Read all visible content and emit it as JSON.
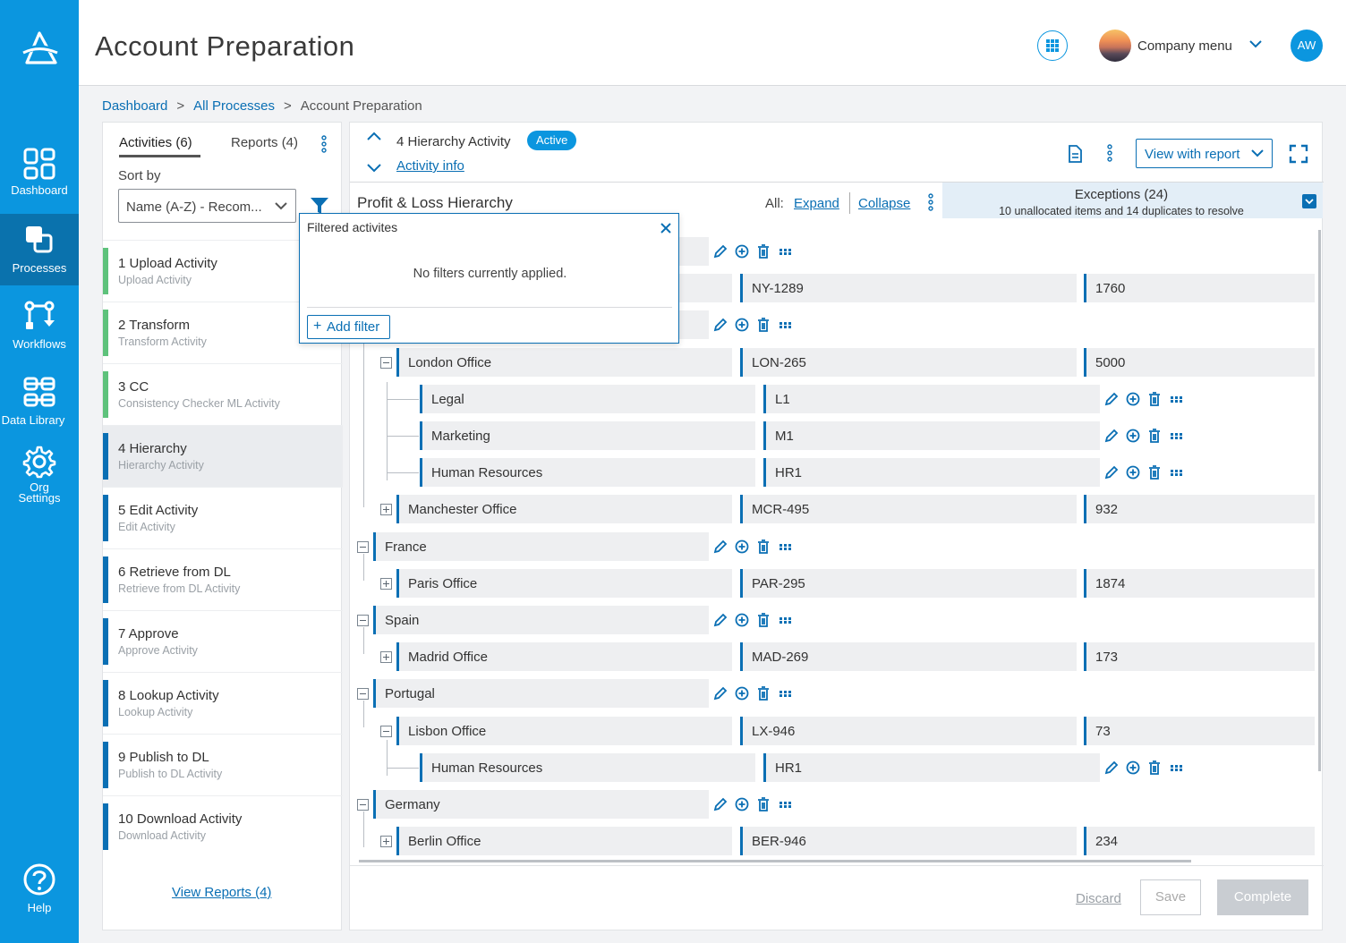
{
  "app": {
    "title": "Account Preparation",
    "accent": "#0b96df"
  },
  "sidebar": {
    "items": [
      {
        "label": "Dashboard",
        "icon": "dashboard-icon"
      },
      {
        "label": "Processes",
        "icon": "processes-icon",
        "active": true
      },
      {
        "label": "Workflows",
        "icon": "workflows-icon"
      },
      {
        "label": "Data Library",
        "icon": "data-library-icon"
      },
      {
        "label": "Org\nSettings",
        "icon": "gear-icon"
      },
      {
        "label": "Help",
        "icon": "help-icon"
      }
    ]
  },
  "header": {
    "company_menu": "Company menu",
    "user_initials": "AW"
  },
  "breadcrumb": {
    "items": [
      "Dashboard",
      "All Processes",
      "Account Preparation"
    ],
    "separator": ">"
  },
  "left": {
    "tab_activities": "Activities (6)",
    "tab_reports": "Reports (4)",
    "sort_by": "Sort by",
    "sort_value": "Name (A-Z) - Recom...",
    "activities": [
      {
        "title": "1 Upload Activity",
        "subtitle": "Upload Activity",
        "color": "#5ec27b"
      },
      {
        "title": "2 Transform",
        "subtitle": "Transform Activity",
        "color": "#5ec27b"
      },
      {
        "title": "3 CC",
        "subtitle": "Consistency Checker ML Activity",
        "color": "#5ec27b"
      },
      {
        "title": "4 Hierarchy",
        "subtitle": "Hierarchy Activity",
        "color": "#0a6fb4"
      },
      {
        "title": "5 Edit Activity",
        "subtitle": "Edit Activity",
        "color": "#0a6fb4"
      },
      {
        "title": "6 Retrieve from DL",
        "subtitle": "Retrieve from DL Activity",
        "color": "#0a6fb4"
      },
      {
        "title": "7 Approve",
        "subtitle": "Approve Activity",
        "color": "#0a6fb4"
      },
      {
        "title": "8 Lookup Activity",
        "subtitle": "Lookup Activity",
        "color": "#0a6fb4"
      },
      {
        "title": "9 Publish to DL",
        "subtitle": "Publish to DL  Activity",
        "color": "#0a6fb4"
      },
      {
        "title": "10 Download Activity",
        "subtitle": "Download Activity",
        "color": "#0a6fb4"
      }
    ],
    "view_reports": "View Reports (4)"
  },
  "right": {
    "activity_title": "4 Hierarchy Activity",
    "status": "Active",
    "activity_info": "Activity info",
    "view_with_report": "View with report",
    "hierarchy_title": "Profit & Loss Hierarchy",
    "all_label": "All:",
    "expand": "Expand",
    "collapse": "Collapse",
    "exceptions_title": "Exceptions (24)",
    "exceptions_sub": "10 unallocated items and 14 duplicates to resolve",
    "rows": [
      {
        "name": "",
        "code": "",
        "value": "",
        "level": 0
      },
      {
        "name": "",
        "code": "NY-1289",
        "value": "1760",
        "level": 1
      },
      {
        "name": "",
        "code": "",
        "value": "",
        "level": 0
      },
      {
        "name": "London Office",
        "code": "LON-265",
        "value": "5000",
        "level": 1
      },
      {
        "name": "Legal",
        "code": "L1",
        "value": "",
        "level": 2
      },
      {
        "name": "Marketing",
        "code": "M1",
        "value": "",
        "level": 2
      },
      {
        "name": "Human Resources",
        "code": "HR1",
        "value": "",
        "level": 2
      },
      {
        "name": "Manchester Office",
        "code": "MCR-495",
        "value": "932",
        "level": 1
      },
      {
        "name": "France",
        "code": "",
        "value": "",
        "level": 0
      },
      {
        "name": "Paris Office",
        "code": "PAR-295",
        "value": "1874",
        "level": 1
      },
      {
        "name": "Spain",
        "code": "",
        "value": "",
        "level": 0
      },
      {
        "name": "Madrid Office",
        "code": "MAD-269",
        "value": "173",
        "level": 1
      },
      {
        "name": "Portugal",
        "code": "",
        "value": "",
        "level": 0
      },
      {
        "name": "Lisbon Office",
        "code": "LX-946",
        "value": "73",
        "level": 1
      },
      {
        "name": "Human Resources",
        "code": "HR1",
        "value": "",
        "level": 2
      },
      {
        "name": "Germany",
        "code": "",
        "value": "",
        "level": 0
      },
      {
        "name": "Berlin Office",
        "code": "BER-946",
        "value": "234",
        "level": 1
      }
    ],
    "discard": "Discard",
    "save": "Save",
    "complete": "Complete"
  },
  "filter_popup": {
    "title": "Filtered activites",
    "message": "No filters currently applied.",
    "add_filter": "Add filter"
  }
}
